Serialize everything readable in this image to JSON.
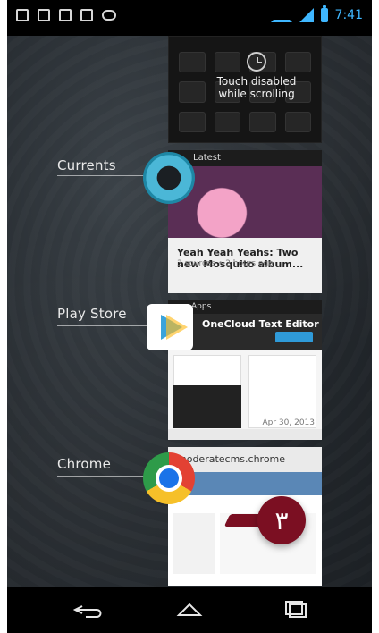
{
  "status_bar": {
    "time": "7:41"
  },
  "recent_apps": {
    "items": [
      {
        "label": "Currents",
        "icon": "currents-icon"
      },
      {
        "label": "Play Store",
        "icon": "play-store-icon"
      },
      {
        "label": "Chrome",
        "icon": "chrome-icon"
      }
    ],
    "thumbnails": {
      "top_overlay_text": "Touch disabled while scrolling",
      "currents": {
        "top_label": "Latest",
        "headline": "Yeah Yeah Yeahs: Two new Mosquito album...",
        "meta": "3 sources  •  2 hours ago"
      },
      "play_store": {
        "top_label": "Apps",
        "title": "OneCloud Text Editor",
        "meta": "Apr 30, 2013"
      },
      "chrome": {
        "url_text": "moderatecms.chrome"
      }
    }
  },
  "callout": {
    "badge_text": "٣"
  },
  "navbar": {
    "buttons": [
      "back",
      "home",
      "recent-apps"
    ]
  }
}
